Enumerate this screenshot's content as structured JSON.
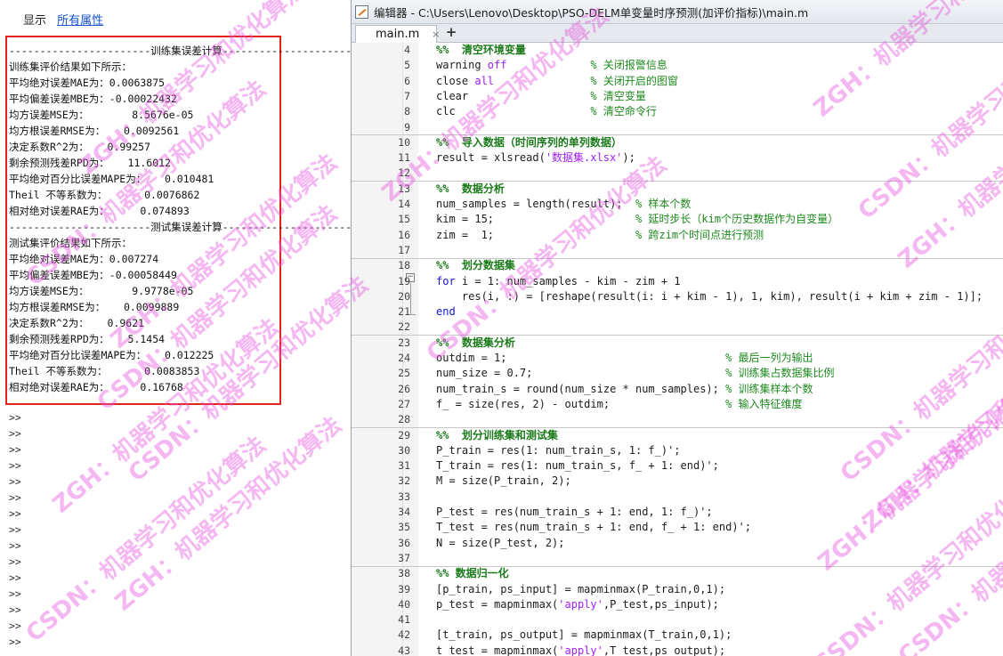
{
  "command_window": {
    "top_links": {
      "show": "显示",
      "all_props": "所有属性"
    },
    "output_lines": [
      "-----------------------训练集误差计算-------------------------",
      "训练集评价结果如下所示：",
      "平均绝对误差MAE为：0.0063875",
      "平均偏差误差MBE为：-0.00022432",
      "均方误差MSE为：       8.5676e-05",
      "均方根误差RMSE为：   0.0092561",
      "决定系数R^2为：   0.99257",
      "剩余预测残差RPD为：   11.6012",
      "平均绝对百分比误差MAPE为：   0.010481",
      "Theil 不等系数为：      0.0076862",
      "相对绝对误差RAE为：     0.074893",
      "-----------------------测试集误差计算-------------------------",
      "测试集评价结果如下所示：",
      "平均绝对误差MAE为：0.007274",
      "平均偏差误差MBE为：-0.00058449",
      "均方误差MSE为：       9.9778e-05",
      "均方根误差RMSE为：   0.0099889",
      "决定系数R^2为：   0.9621",
      "剩余预测残差RPD为：   5.1454",
      "平均绝对百分比误差MAPE为：   0.012225",
      "Theil 不等系数为：      0.0083853",
      "相对绝对误差RAE为：     0.16768"
    ],
    "prompt": ">>",
    "prompt_count": 15
  },
  "editor": {
    "title": "编辑器 - C:\\Users\\Lenovo\\Desktop\\PSO-DELM单变量时序预测(加评价指标)\\main.m",
    "tab_label": "main.m",
    "tab_close": "×",
    "tab_add": "+",
    "lines": [
      {
        "n": "4",
        "html": "<span class=\"sec\">%%  清空环境变量</span>"
      },
      {
        "n": "5",
        "html": "warning <span class=\"st\">off</span>             <span class=\"cm\">% 关闭报警信息</span>"
      },
      {
        "n": "6",
        "html": "close <span class=\"st\">all</span>               <span class=\"cm\">% 关闭开启的图窗</span>"
      },
      {
        "n": "7",
        "html": "clear                   <span class=\"cm\">% 清空变量</span>"
      },
      {
        "n": "8",
        "html": "clc                     <span class=\"cm\">% 清空命令行</span>"
      },
      {
        "n": "9",
        "html": "",
        "sep": true
      },
      {
        "n": "10",
        "html": "<span class=\"sec\">%%  导入数据（时间序列的单列数据）</span>"
      },
      {
        "n": "11",
        "html": "result = xlsread(<span class=\"st\">'数据集.xlsx'</span>);"
      },
      {
        "n": "12",
        "html": "",
        "sep": true
      },
      {
        "n": "13",
        "html": "<span class=\"sec\">%%  数据分析</span>"
      },
      {
        "n": "14",
        "html": "num_samples = length(result);  <span class=\"cm\">% 样本个数</span>"
      },
      {
        "n": "15",
        "html": "kim = 15;                      <span class=\"cm\">% 延时步长（kim个历史数据作为自变量）</span>"
      },
      {
        "n": "16",
        "html": "zim =  1;                      <span class=\"cm\">% 跨zim个时间点进行预测</span>"
      },
      {
        "n": "17",
        "html": "",
        "sep": true
      },
      {
        "n": "18",
        "html": "<span class=\"sec\">%%  划分数据集</span>"
      },
      {
        "n": "19",
        "html": "<span class=\"kw\">for</span> i = 1: num_samples - kim - zim + 1"
      },
      {
        "n": "20",
        "html": "    res(i, :) = [reshape(result(i: i + kim - 1), 1, kim), result(i + kim + zim - 1)];"
      },
      {
        "n": "21",
        "html": "<span class=\"kw\">end</span>"
      },
      {
        "n": "22",
        "html": "",
        "sep": true
      },
      {
        "n": "23",
        "html": "<span class=\"sec\">%%  数据集分析</span>"
      },
      {
        "n": "24",
        "html": "outdim = 1;                                  <span class=\"cm\">% 最后一列为输出</span>"
      },
      {
        "n": "25",
        "html": "num_size = 0.7;                              <span class=\"cm\">% 训练集占数据集比例</span>"
      },
      {
        "n": "26",
        "html": "num_train_s = round(num_size * num_samples); <span class=\"cm\">% 训练集样本个数</span>"
      },
      {
        "n": "27",
        "html": "f_ = size(res, 2) - outdim;                  <span class=\"cm\">% 输入特征维度</span>"
      },
      {
        "n": "28",
        "html": "",
        "sep": true
      },
      {
        "n": "29",
        "html": "<span class=\"sec\">%%  划分训练集和测试集</span>"
      },
      {
        "n": "30",
        "html": "P_train = res(1: num_train_s, 1: f_)';"
      },
      {
        "n": "31",
        "html": "T_train = res(1: num_train_s, f_ + 1: end)';"
      },
      {
        "n": "32",
        "html": "M = size(P_train, 2);"
      },
      {
        "n": "33",
        "html": ""
      },
      {
        "n": "34",
        "html": "P_test = res(num_train_s + 1: end, 1: f_)';"
      },
      {
        "n": "35",
        "html": "T_test = res(num_train_s + 1: end, f_ + 1: end)';"
      },
      {
        "n": "36",
        "html": "N = size(P_test, 2);"
      },
      {
        "n": "37",
        "html": "",
        "sep": true
      },
      {
        "n": "38",
        "html": "<span class=\"sec\">%% 数据归一化</span>"
      },
      {
        "n": "39",
        "html": "[p_train, ps_input] = mapminmax(P_train,0,1);"
      },
      {
        "n": "40",
        "html": "p_test = mapminmax(<span class=\"st\">'apply'</span>,P_test,ps_input);"
      },
      {
        "n": "41",
        "html": ""
      },
      {
        "n": "42",
        "html": "[t_train, ps_output] = mapminmax(T_train,0,1);"
      },
      {
        "n": "43",
        "html": "t_test = mapminmax(<span class=\"st\">'apply'</span>,T_test,ps_output);"
      }
    ]
  },
  "watermark": {
    "texts": [
      "ZGH：机器学习和优化算法",
      "CSDN：机器学习和优化算法"
    ],
    "color": "#e854e0"
  }
}
